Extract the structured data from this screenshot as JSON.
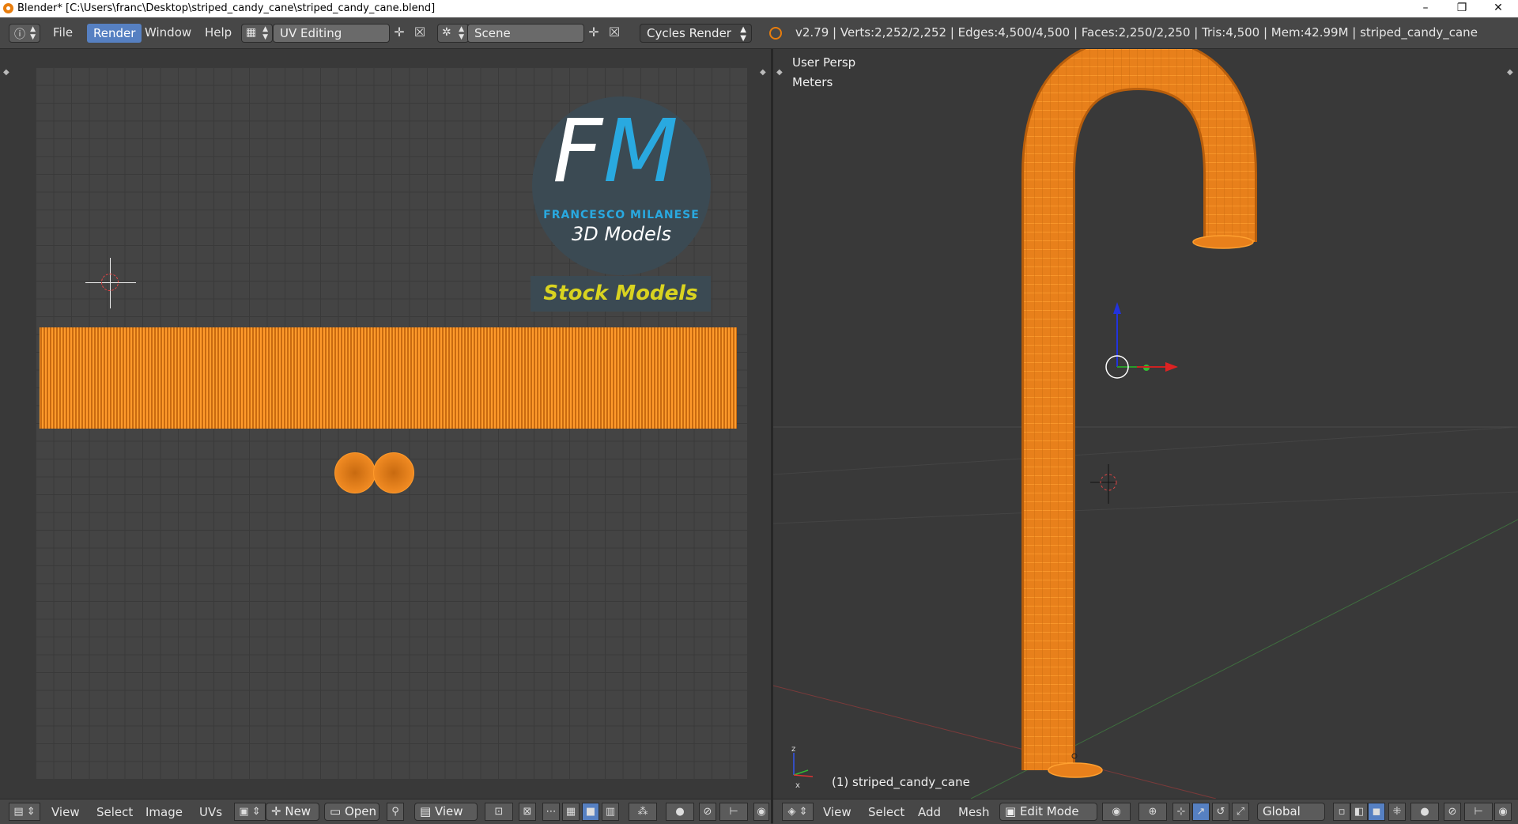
{
  "window": {
    "title": "Blender* [C:\\Users\\franc\\Desktop\\striped_candy_cane\\striped_candy_cane.blend]",
    "controls": [
      "–",
      "❐",
      "✕"
    ]
  },
  "info_header": {
    "menus": [
      "File",
      "Render",
      "Window",
      "Help"
    ],
    "active_menu": "Render",
    "screen_layout": "UV Editing",
    "scene": "Scene",
    "render_engine": "Cycles Render",
    "stats": "v2.79 | Verts:2,252/2,252 | Edges:4,500/4,500 | Faces:2,250/2,250 | Tris:4,500 | Mem:42.99M | striped_candy_cane"
  },
  "uv_editor": {
    "logo": {
      "letters_f": "F",
      "letters_m": "M",
      "name": "FRANCESCO MILANESE",
      "subtitle": "3D Models",
      "banner": "Stock Models"
    },
    "footer": {
      "menus": [
        "View",
        "Select",
        "Image",
        "UVs"
      ],
      "new_label": "New",
      "open_label": "Open",
      "view_label": "View"
    }
  },
  "viewport_3d": {
    "view_name": "User Persp",
    "units": "Meters",
    "object_label": "(1) striped_candy_cane",
    "footer": {
      "menus": [
        "View",
        "Select",
        "Add",
        "Mesh"
      ],
      "mode": "Edit Mode",
      "orientation": "Global"
    }
  },
  "colors": {
    "mesh_orange": "#e8801b",
    "logo_blue": "#29a9e0",
    "logo_bg": "#3b4a53",
    "banner_text": "#d9d320",
    "active_menu": "#5680c2"
  }
}
